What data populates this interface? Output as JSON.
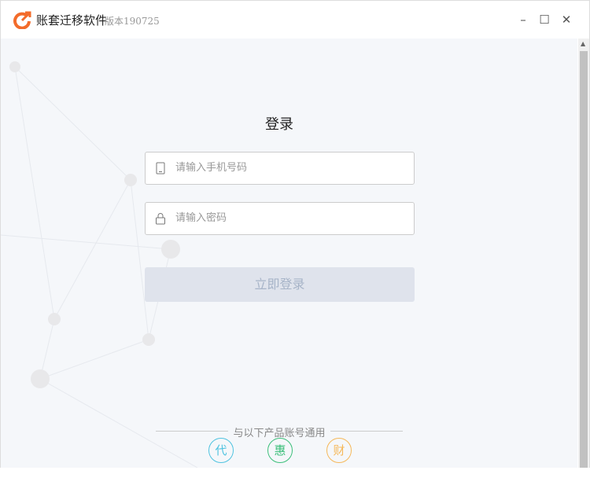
{
  "app": {
    "title": "账套迁移软件",
    "version": "版本190725"
  },
  "login": {
    "heading": "登录",
    "phone_placeholder": "请输入手机号码",
    "password_placeholder": "请输入密码",
    "submit": "立即登录"
  },
  "products": {
    "label": "与以下产品账号通用",
    "items": [
      {
        "char": "代",
        "color": "#4fc3e0"
      },
      {
        "char": "惠",
        "color": "#3cbf7a"
      },
      {
        "char": "财",
        "color": "#f5b85a"
      }
    ]
  },
  "window": {
    "minimize": "–",
    "maximize": "☐",
    "close": "✕"
  }
}
